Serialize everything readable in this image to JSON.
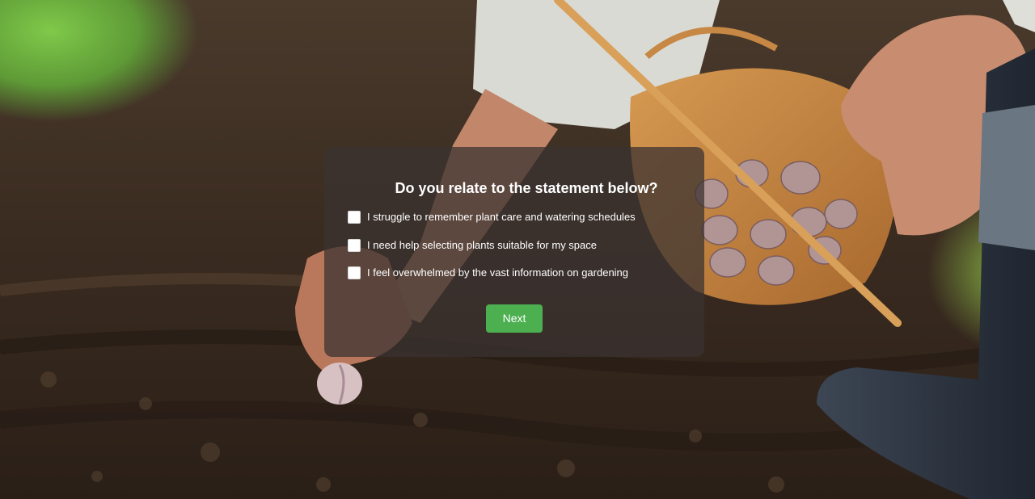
{
  "survey": {
    "question": "Do you relate to the statement below?",
    "options": [
      {
        "label": "I struggle to remember plant care and watering schedules",
        "checked": false
      },
      {
        "label": "I need help selecting plants suitable for my space",
        "checked": false
      },
      {
        "label": "I feel overwhelmed by the vast information on gardening",
        "checked": false
      }
    ],
    "next_label": "Next"
  },
  "colors": {
    "overlay": "#3a3230",
    "button": "#4caf50",
    "text": "#ffffff"
  },
  "background": {
    "subject": "hands-planting-garlic-cloves-in-soil-photo"
  }
}
